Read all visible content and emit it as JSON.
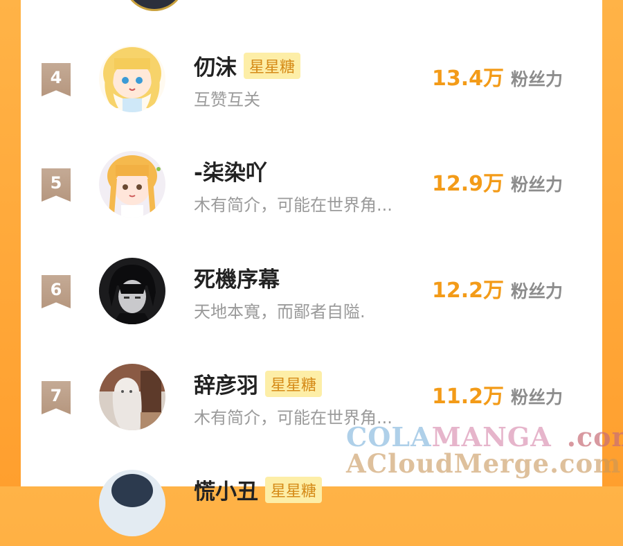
{
  "ranking": [
    {
      "rank": "4",
      "name": "仞沫",
      "badge": "星星糖",
      "bio": "互赞互关",
      "fans": "13.4万",
      "fans_unit": "粉丝力"
    },
    {
      "rank": "5",
      "name": "-柒染吖",
      "badge": "",
      "bio": "木有简介，可能在世界角...",
      "fans": "12.9万",
      "fans_unit": "粉丝力"
    },
    {
      "rank": "6",
      "name": "死機序幕",
      "badge": "",
      "bio": "天地本寬，而鄙者自隘.",
      "fans": "12.2万",
      "fans_unit": "粉丝力"
    },
    {
      "rank": "7",
      "name": "辞彦羽",
      "badge": "星星糖",
      "bio": "木有简介，可能在世界角...",
      "fans": "11.2万",
      "fans_unit": "粉丝力"
    },
    {
      "rank": "",
      "name": "慌小丑",
      "badge": "星星糖",
      "bio": "",
      "fans": "",
      "fans_unit": ""
    }
  ],
  "watermark": {
    "line1_a": "COLA",
    "line1_b": "MANGA",
    "line1_c": ".com",
    "line2": "ACloudMerge.com"
  }
}
